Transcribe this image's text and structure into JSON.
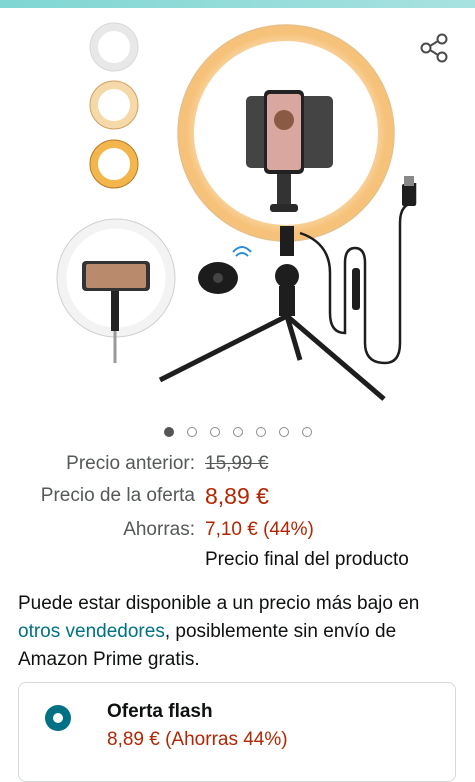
{
  "gallery": {
    "image_count": 7,
    "active_index": 0
  },
  "pricing": {
    "previous_label": "Precio anterior:",
    "previous_value": "15,99 €",
    "deal_label": "Precio de la oferta",
    "deal_value": "8,89 €",
    "savings_label": "Ahorras:",
    "savings_value": "7,10 € (44%)",
    "final_note": "Precio final del producto"
  },
  "availability": {
    "text_before": "Puede estar disponible a un precio más bajo en ",
    "link": "otros vendedores",
    "text_after": ", posiblemente sin envío de Amazon Prime gratis."
  },
  "offer": {
    "title": "Oferta flash",
    "price": "8,89 € (Ahorras 44%)"
  },
  "colors": {
    "price_red": "#b12704",
    "link_teal": "#007185"
  }
}
